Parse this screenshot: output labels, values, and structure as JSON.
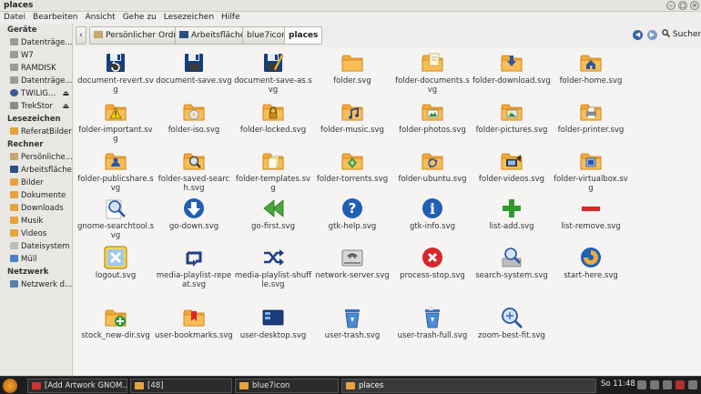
{
  "window": {
    "title": "places",
    "controls": [
      "–",
      "□",
      "×"
    ]
  },
  "menubar": [
    "Datei",
    "Bearbeiten",
    "Ansicht",
    "Gehe zu",
    "Lesezeichen",
    "Hilfe"
  ],
  "sidebar": {
    "sections": [
      {
        "header": "Geräte",
        "items": [
          {
            "label": "Datenträge...",
            "icon": "drive-icon",
            "eject": false
          },
          {
            "label": "W7",
            "icon": "drive-icon",
            "eject": false
          },
          {
            "label": "RAMDISK",
            "icon": "drive-icon",
            "eject": false
          },
          {
            "label": "Datenträge...",
            "icon": "drive-icon",
            "eject": false
          },
          {
            "label": "TWILIG...",
            "icon": "disc-icon",
            "eject": true
          },
          {
            "label": "TrekStor",
            "icon": "usb-drive-icon",
            "eject": true
          }
        ]
      },
      {
        "header": "Lesezeichen",
        "items": [
          {
            "label": "ReferatBilder",
            "icon": "folder-icon",
            "eject": false
          }
        ]
      },
      {
        "header": "Rechner",
        "items": [
          {
            "label": "Persönliche...",
            "icon": "home-folder-icon",
            "eject": false
          },
          {
            "label": "Arbeitsfläche",
            "icon": "desktop-icon",
            "eject": false
          },
          {
            "label": "Bilder",
            "icon": "pictures-folder-icon",
            "eject": false
          },
          {
            "label": "Dokumente",
            "icon": "documents-folder-icon",
            "eject": false
          },
          {
            "label": "Downloads",
            "icon": "downloads-folder-icon",
            "eject": false
          },
          {
            "label": "Musik",
            "icon": "music-folder-icon",
            "eject": false
          },
          {
            "label": "Videos",
            "icon": "videos-folder-icon",
            "eject": false
          },
          {
            "label": "Dateisystem",
            "icon": "filesystem-icon",
            "eject": false
          },
          {
            "label": "Müll",
            "icon": "trash-icon",
            "eject": false
          }
        ]
      },
      {
        "header": "Netzwerk",
        "items": [
          {
            "label": "Netzwerk d...",
            "icon": "network-icon",
            "eject": false
          }
        ]
      }
    ]
  },
  "toolbar": {
    "breadcrumbs": [
      "Persönlicher Ordner",
      "Arbeitsfläche",
      "blue7icon",
      "places"
    ],
    "search_label": "Suchen"
  },
  "files": [
    {
      "name": "document-revert.svg",
      "icon": "document-revert-icon"
    },
    {
      "name": "document-save.svg",
      "icon": "floppy-save-icon"
    },
    {
      "name": "document-save-as.svg",
      "icon": "floppy-save-as-icon"
    },
    {
      "name": "folder.svg",
      "icon": "folder-icon"
    },
    {
      "name": "folder-documents.svg",
      "icon": "folder-documents-icon"
    },
    {
      "name": "folder-download.svg",
      "icon": "folder-download-icon"
    },
    {
      "name": "folder-home.svg",
      "icon": "folder-home-icon"
    },
    {
      "name": "folder-important.svg",
      "icon": "folder-important-icon"
    },
    {
      "name": "folder-iso.svg",
      "icon": "folder-iso-icon"
    },
    {
      "name": "folder-locked.svg",
      "icon": "folder-locked-icon"
    },
    {
      "name": "folder-music.svg",
      "icon": "folder-music-icon"
    },
    {
      "name": "folder-photos.svg",
      "icon": "folder-photos-icon"
    },
    {
      "name": "folder-pictures.svg",
      "icon": "folder-pictures-icon"
    },
    {
      "name": "folder-printer.svg",
      "icon": "folder-printer-icon"
    },
    {
      "name": "folder-publicshare.svg",
      "icon": "folder-publicshare-icon"
    },
    {
      "name": "folder-saved-search.svg",
      "icon": "folder-saved-search-icon"
    },
    {
      "name": "folder-templates.svg",
      "icon": "folder-templates-icon"
    },
    {
      "name": "folder-torrents.svg",
      "icon": "folder-torrents-icon"
    },
    {
      "name": "folder-ubuntu.svg",
      "icon": "folder-ubuntu-icon"
    },
    {
      "name": "folder-videos.svg",
      "icon": "folder-videos-icon"
    },
    {
      "name": "folder-virtualbox.svg",
      "icon": "folder-virtualbox-icon"
    },
    {
      "name": "gnome-searchtool.svg",
      "icon": "searchtool-icon"
    },
    {
      "name": "go-down.svg",
      "icon": "go-down-icon"
    },
    {
      "name": "go-first.svg",
      "icon": "go-first-icon"
    },
    {
      "name": "gtk-help.svg",
      "icon": "help-icon"
    },
    {
      "name": "gtk-info.svg",
      "icon": "info-icon"
    },
    {
      "name": "list-add.svg",
      "icon": "plus-icon"
    },
    {
      "name": "list-remove.svg",
      "icon": "minus-icon"
    },
    {
      "name": "logout.svg",
      "icon": "logout-icon"
    },
    {
      "name": "media-playlist-repeat.svg",
      "icon": "repeat-icon"
    },
    {
      "name": "media-playlist-shuffle.svg",
      "icon": "shuffle-icon"
    },
    {
      "name": "network-server.svg",
      "icon": "server-icon"
    },
    {
      "name": "process-stop.svg",
      "icon": "stop-icon"
    },
    {
      "name": "search-system.svg",
      "icon": "search-system-icon"
    },
    {
      "name": "start-here.svg",
      "icon": "start-here-icon"
    },
    {
      "name": "stock_new-dir.svg",
      "icon": "new-folder-icon"
    },
    {
      "name": "user-bookmarks.svg",
      "icon": "folder-bookmarks-icon"
    },
    {
      "name": "user-desktop.svg",
      "icon": "desktop-icon"
    },
    {
      "name": "user-trash.svg",
      "icon": "trash-icon"
    },
    {
      "name": "user-trash-full.svg",
      "icon": "trash-full-icon"
    },
    {
      "name": "zoom-best-fit.svg",
      "icon": "zoom-best-fit-icon"
    }
  ],
  "taskbar": {
    "tasks": [
      {
        "label": "[Add Artwork GNOM..."
      },
      {
        "label": "[48]"
      },
      {
        "label": "blue7icon"
      },
      {
        "label": "places"
      }
    ],
    "clock": "So 11:48"
  },
  "colors": {
    "folder": "#f3a939",
    "blue": "#1f5fb4",
    "green": "#2e9a2e",
    "red": "#d8262a"
  }
}
